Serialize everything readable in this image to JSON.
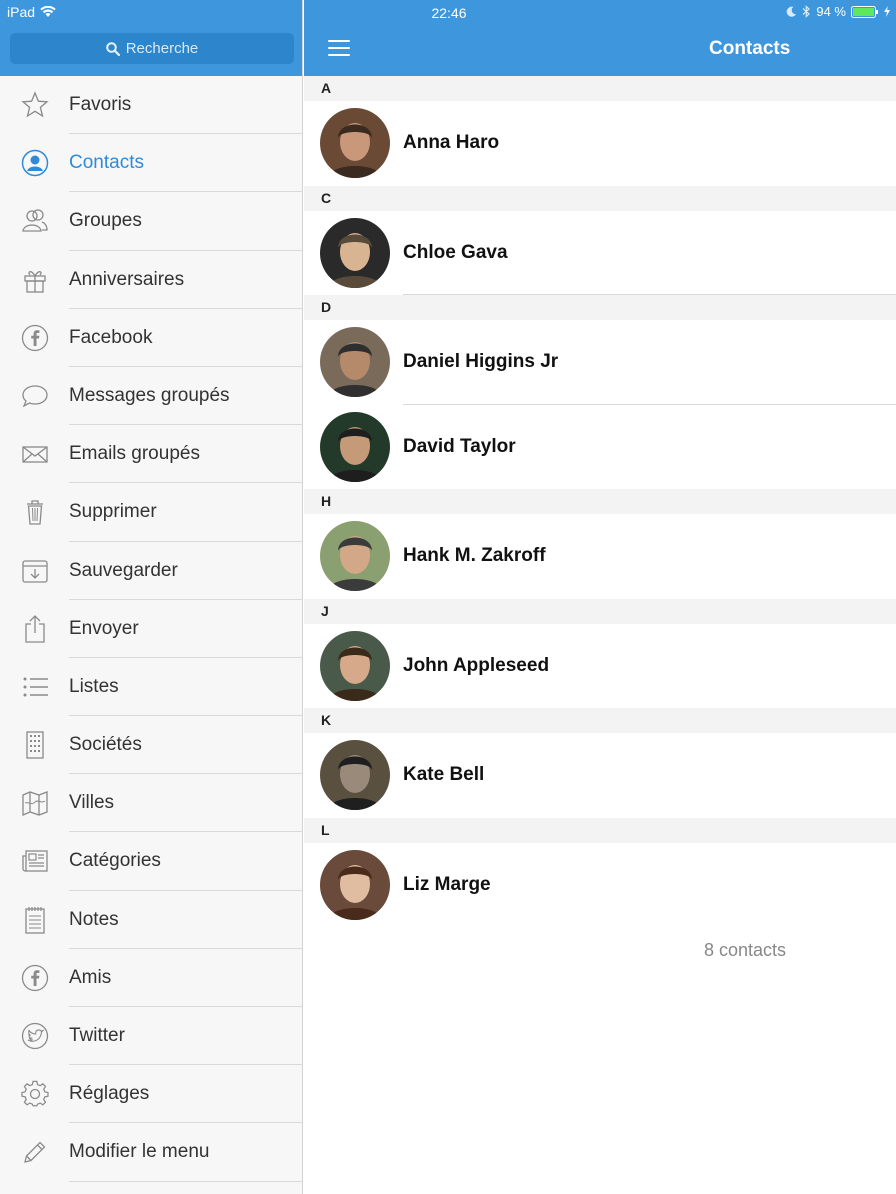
{
  "status_bar": {
    "device": "iPad",
    "time": "22:46",
    "battery": "94 %"
  },
  "sidebar": {
    "search_placeholder": "Recherche",
    "items": [
      {
        "label": "Favoris",
        "icon": "star-icon"
      },
      {
        "label": "Contacts",
        "icon": "person-circle-icon"
      },
      {
        "label": "Groupes",
        "icon": "group-icon"
      },
      {
        "label": "Anniversaires",
        "icon": "gift-icon"
      },
      {
        "label": "Facebook",
        "icon": "facebook-icon"
      },
      {
        "label": "Messages groupés",
        "icon": "speech-bubble-icon"
      },
      {
        "label": "Emails groupés",
        "icon": "envelope-icon"
      },
      {
        "label": "Supprimer",
        "icon": "trash-icon"
      },
      {
        "label": "Sauvegarder",
        "icon": "save-tray-icon"
      },
      {
        "label": "Envoyer",
        "icon": "share-icon"
      },
      {
        "label": "Listes",
        "icon": "list-icon"
      },
      {
        "label": "Sociétés",
        "icon": "building-icon"
      },
      {
        "label": "Villes",
        "icon": "map-icon"
      },
      {
        "label": "Catégories",
        "icon": "newspaper-icon"
      },
      {
        "label": "Notes",
        "icon": "notepad-icon"
      },
      {
        "label": "Amis",
        "icon": "facebook-icon"
      },
      {
        "label": "Twitter",
        "icon": "twitter-bird-icon"
      },
      {
        "label": "Réglages",
        "icon": "gear-icon"
      },
      {
        "label": "Modifier le menu",
        "icon": "pencil-icon"
      }
    ],
    "active_index": 1,
    "accent_color": "#2f8bd8"
  },
  "main": {
    "title": "Contacts",
    "header_color": "#3e97dc",
    "sections": [
      {
        "letter": "A",
        "contacts": [
          "Anna Haro"
        ]
      },
      {
        "letter": "C",
        "contacts": [
          "Chloe Gava"
        ]
      },
      {
        "letter": "D",
        "contacts": [
          "Daniel Higgins Jr",
          "David Taylor"
        ]
      },
      {
        "letter": "H",
        "contacts": [
          "Hank M. Zakroff"
        ]
      },
      {
        "letter": "J",
        "contacts": [
          "John Appleseed"
        ]
      },
      {
        "letter": "K",
        "contacts": [
          "Kate Bell"
        ]
      },
      {
        "letter": "L",
        "contacts": [
          "Liz Marge"
        ]
      }
    ],
    "count_label": "8 contacts"
  }
}
